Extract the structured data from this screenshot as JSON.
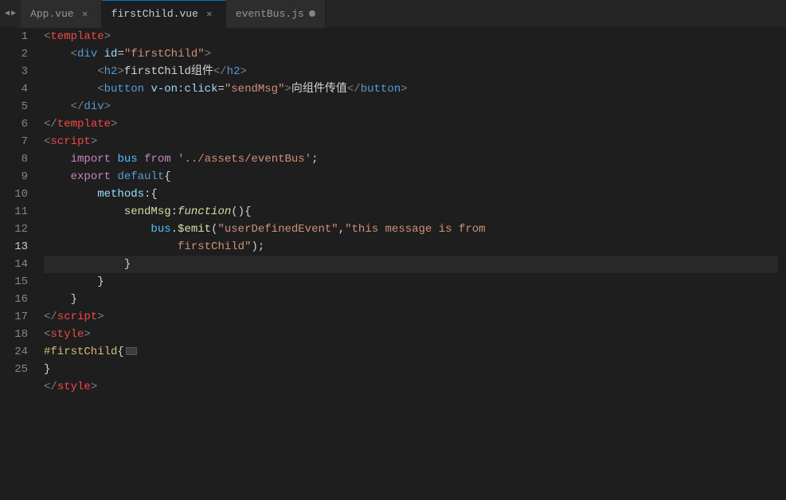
{
  "tabs": [
    {
      "id": "app-vue",
      "label": "App.vue",
      "active": false,
      "has_close": true,
      "has_dot": false
    },
    {
      "id": "first-child-vue",
      "label": "firstChild.vue",
      "active": true,
      "has_close": true,
      "has_dot": false
    },
    {
      "id": "event-bus-js",
      "label": "eventBus.js",
      "active": false,
      "has_close": false,
      "has_dot": true
    }
  ],
  "lines": [
    {
      "num": "1",
      "active": false
    },
    {
      "num": "2",
      "active": false
    },
    {
      "num": "3",
      "active": false
    },
    {
      "num": "4",
      "active": false
    },
    {
      "num": "5",
      "active": false
    },
    {
      "num": "6",
      "active": false
    },
    {
      "num": "7",
      "active": false
    },
    {
      "num": "8",
      "active": false
    },
    {
      "num": "9",
      "active": false
    },
    {
      "num": "10",
      "active": false
    },
    {
      "num": "11",
      "active": false
    },
    {
      "num": "12",
      "active": false
    },
    {
      "num": "13",
      "active": true
    },
    {
      "num": "14",
      "active": false
    },
    {
      "num": "15",
      "active": false
    },
    {
      "num": "16",
      "active": false
    },
    {
      "num": "17",
      "active": false
    },
    {
      "num": "18",
      "active": false
    },
    {
      "num": "24",
      "active": false
    },
    {
      "num": "25",
      "active": false
    }
  ]
}
